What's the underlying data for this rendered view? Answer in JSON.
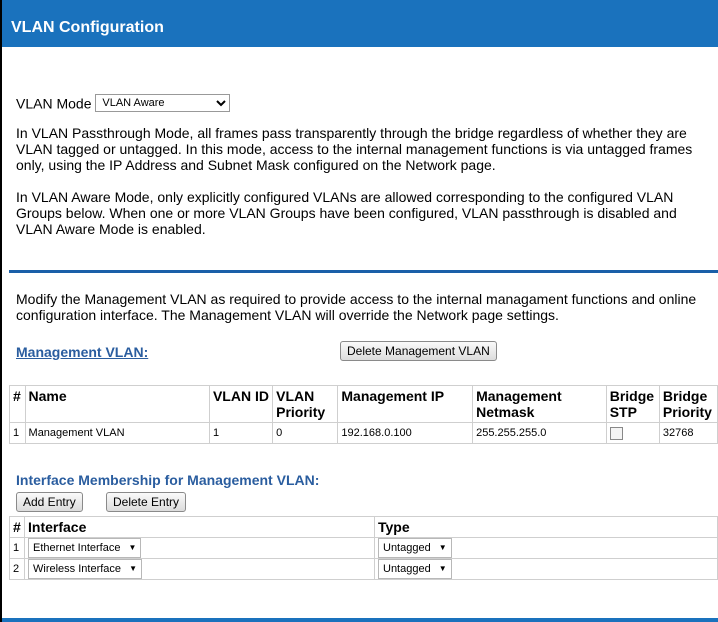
{
  "header": {
    "title": "VLAN Configuration"
  },
  "mode": {
    "label": "VLAN Mode",
    "selected": "VLAN Aware"
  },
  "paragraphs": {
    "passthrough": "In VLAN Passthrough Mode, all frames pass transparently through the bridge regardless of whether they are VLAN tagged or untagged. In this mode, access to the internal management functions is via untagged frames only, using the IP Address and Subnet Mask configured on the Network page.",
    "aware": "In VLAN Aware Mode, only explicitly configured VLANs are allowed corresponding to the configured VLAN Groups below. When one or more VLAN Groups have been configured, VLAN passthrough is disabled and VLAN Aware Mode is enabled.",
    "management": "Modify the Management VLAN as required to provide access to the internal managament functions and online configuration interface. The Management VLAN will override the Network page settings."
  },
  "management": {
    "section_label": "Management VLAN:",
    "delete_button": "Delete Management VLAN",
    "columns": [
      "#",
      "Name",
      "VLAN ID",
      "VLAN Priority",
      "Management IP",
      "Management Netmask",
      "Bridge STP",
      "Bridge Priority"
    ],
    "rows": [
      {
        "num": "1",
        "name": "Management VLAN",
        "vlan_id": "1",
        "priority": "0",
        "ip": "192.168.0.100",
        "netmask": "255.255.255.0",
        "stp_checked": false,
        "bridge_priority": "32768"
      }
    ]
  },
  "interfaces": {
    "title": "Interface Membership for Management VLAN:",
    "add_button": "Add Entry",
    "delete_button": "Delete Entry",
    "columns": [
      "#",
      "Interface",
      "Type"
    ],
    "rows": [
      {
        "num": "1",
        "interface": "Ethernet Interface",
        "type": "Untagged"
      },
      {
        "num": "2",
        "interface": "Wireless Interface",
        "type": "Untagged"
      }
    ]
  }
}
